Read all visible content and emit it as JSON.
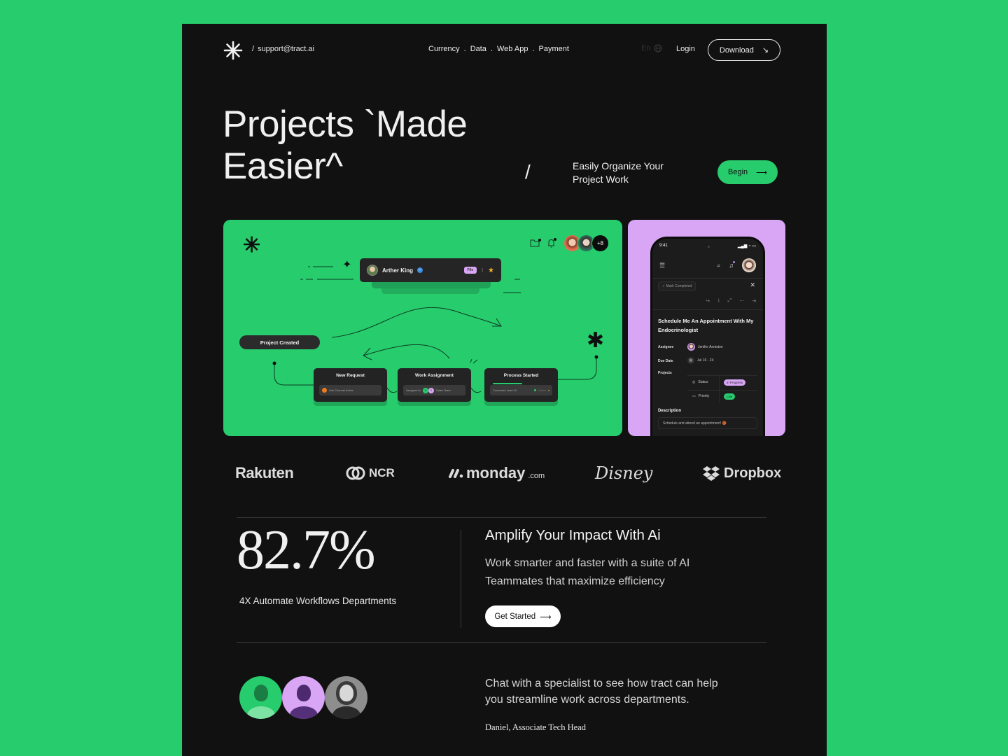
{
  "header": {
    "support_slash": "/",
    "support_email": "support@tract.ai",
    "nav": [
      {
        "label": "Currency"
      },
      {
        "label": "Data"
      },
      {
        "label": "Web App"
      },
      {
        "label": "Payment"
      }
    ],
    "nav_separator": ".",
    "language": "En",
    "login_label": "Login",
    "download_label": "Download",
    "download_icon": "↘"
  },
  "hero": {
    "title_line1": "Projects `Made",
    "title_line2": "Easier^",
    "slash": "/",
    "subtitle": "Easily Organize Your Project Work",
    "begin_label": "Begin",
    "begin_icon": "⟶"
  },
  "workflow": {
    "person_name": "Arther King",
    "file_chip": "File",
    "avatar_more": "+8",
    "project_created": "Project Created",
    "steps": [
      {
        "title": "New Request",
        "detail": "Ads Channel Active"
      },
      {
        "title": "Work Assignment",
        "detail_prefix": "Assigned to",
        "chip_v": "V",
        "chip_c": "C",
        "detail_suffix": "Sales Team"
      },
      {
        "title": "Process Started",
        "detail": "Converted Lead 4X",
        "status": "Active"
      }
    ]
  },
  "phone": {
    "time": "9:41",
    "mark_completed": "✓ Mark Completed",
    "task_title": "Schedule Me An Appointment With My Endocrinologist",
    "assignee_label": "Assignee",
    "assignee_value": "Jenifer Anniston",
    "due_label": "Due Date",
    "due_value": "Jul 16 - 24",
    "projects_label": "Projects",
    "status_label": "Status",
    "status_value": "In Progress",
    "priority_label": "Priority",
    "priority_value": "Low",
    "description_label": "Description",
    "description_value": "Schedule and attend an appointment! 🏀"
  },
  "logos": {
    "rakuten": "Rakuten",
    "ncr": "NCR",
    "monday": "monday",
    "monday_suffix": ".com",
    "disney": "Disney",
    "dropbox": "Dropbox"
  },
  "stats": {
    "value": "82.7%",
    "caption": "4X Automate Workflows Departments",
    "title": "Amplify Your Impact With Ai",
    "subtitle": "Work smarter and faster with a suite of AI Teammates that maximize efficiency",
    "cta_label": "Get Started",
    "cta_icon": "⟶"
  },
  "testimonial": {
    "quote": "Chat with a specialist to see how tract can help you streamline work across departments.",
    "author": "Daniel, Associate Tech Head"
  },
  "colors": {
    "background": "#27cc6d",
    "page": "#111111",
    "accent_green": "#27cc6d",
    "accent_purple": "#d9a5f5"
  }
}
